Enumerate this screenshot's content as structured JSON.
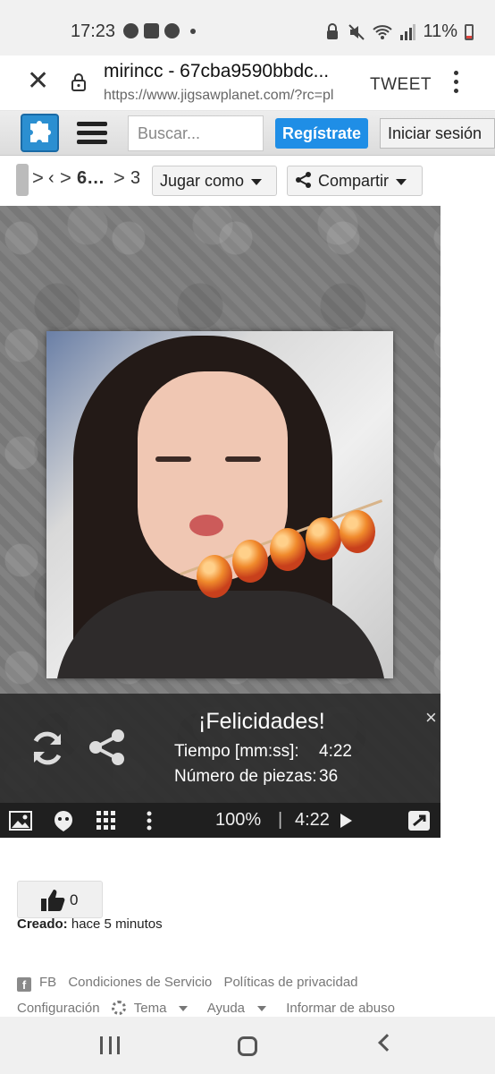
{
  "status_bar": {
    "time": "17:23",
    "battery": "11%"
  },
  "browser": {
    "page_title": "mirincc - 67cba9590bbdc...",
    "url": "https://www.jigsawplanet.com/?rc=pl",
    "tweet_label": "TWEET"
  },
  "site_header": {
    "search_placeholder": "Buscar...",
    "register_label": "Regístrate",
    "login_label": "Iniciar sesión",
    "accent_color": "#1f8ee6"
  },
  "breadcrumb": {
    "item1": "‹",
    "item2": "6…",
    "item3": "3",
    "play_as_label": "Jugar como",
    "share_label": "Compartir"
  },
  "congrats": {
    "headline": "¡Felicidades!",
    "time_label": "Tiempo [mm:ss]:",
    "time_value": "4:22",
    "pieces_label": "Número de piezas:",
    "pieces_value": "36",
    "close": "×"
  },
  "toolbar": {
    "zoom": "100%",
    "separator": "|",
    "timer": "4:22"
  },
  "meta": {
    "like_count": "0",
    "created_label": "Creado:",
    "created_value": "hace 5 minutos"
  },
  "footer": {
    "fb": "FB",
    "terms": "Condiciones de Servicio",
    "privacy": "Políticas de privacidad",
    "settings": "Configuración",
    "theme": "Tema",
    "help": "Ayuda",
    "report": "Informar de abuso"
  }
}
